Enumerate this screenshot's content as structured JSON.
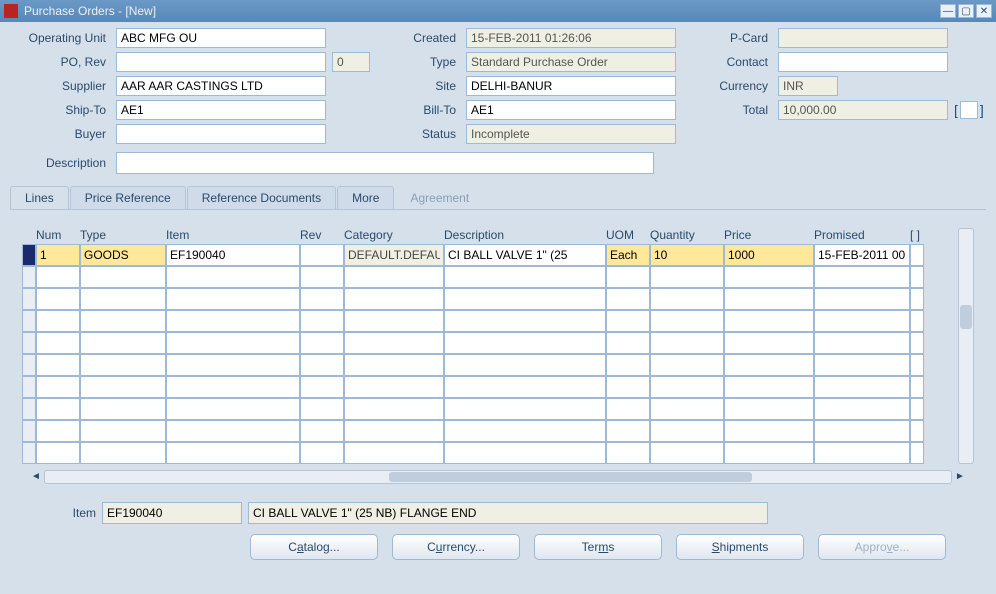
{
  "window": {
    "title": "Purchase Orders - [New]"
  },
  "header": {
    "labels": {
      "operating_unit": "Operating Unit",
      "po_rev": "PO, Rev",
      "supplier": "Supplier",
      "ship_to": "Ship-To",
      "buyer": "Buyer",
      "description": "Description",
      "created": "Created",
      "type": "Type",
      "site": "Site",
      "bill_to": "Bill-To",
      "status": "Status",
      "pcard": "P-Card",
      "contact": "Contact",
      "currency": "Currency",
      "total": "Total"
    },
    "operating_unit": "ABC MFG OU",
    "po": "",
    "rev": "0",
    "supplier": "AAR AAR CASTINGS LTD",
    "ship_to": "AE1",
    "buyer": "",
    "description": "",
    "created": "15-FEB-2011 01:26:06",
    "type": "Standard Purchase Order",
    "site": "DELHI-BANUR",
    "bill_to": "AE1",
    "status": "Incomplete",
    "pcard": "",
    "contact": "",
    "currency": "INR",
    "total": "10,000.00"
  },
  "tabs": {
    "lines": "Lines",
    "price_ref": "Price Reference",
    "ref_docs": "Reference Documents",
    "more": "More",
    "agreement": "Agreement"
  },
  "grid": {
    "columns": {
      "num": "Num",
      "type": "Type",
      "item": "Item",
      "rev": "Rev",
      "category": "Category",
      "description": "Description",
      "uom": "UOM",
      "quantity": "Quantity",
      "price": "Price",
      "promised": "Promised",
      "flag": "[ ]"
    },
    "rows": [
      {
        "num": "1",
        "type": "GOODS",
        "item": "EF190040",
        "rev": "",
        "category": "DEFAULT.DEFAU",
        "description": "CI BALL VALVE 1\" (25",
        "uom": "Each",
        "quantity": "10",
        "price": "1000",
        "promised": "15-FEB-2011 00"
      }
    ],
    "empty_rows": 9
  },
  "summary": {
    "label": "Item",
    "item": "EF190040",
    "description": "CI BALL VALVE 1\" (25 NB) FLANGE END"
  },
  "buttons": {
    "catalog": "Catalog...",
    "currency": "Currency...",
    "terms": "Terms",
    "shipments": "Shipments",
    "approve": "Approve..."
  }
}
